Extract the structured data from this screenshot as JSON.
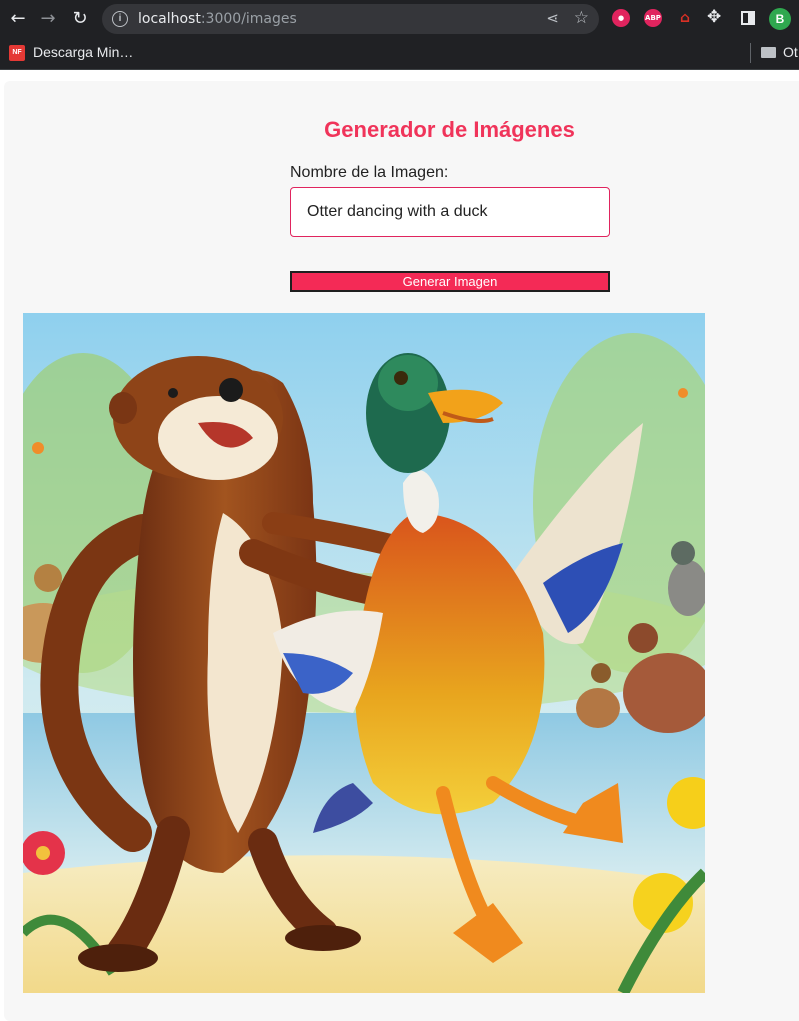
{
  "browser": {
    "url_host": "localhost",
    "url_path": ":3000/images",
    "profile_initial": "B",
    "extensions": [
      {
        "name": "record-extension",
        "label": "",
        "color": "#e0245e"
      },
      {
        "name": "adblock-extension",
        "label": "ABP",
        "color": "#e0245e"
      },
      {
        "name": "grad-cap-extension",
        "label": "",
        "color": "#c0392b"
      }
    ]
  },
  "bookmarks": {
    "item_label": "Descarga Min…",
    "item_favicon": "NF",
    "folder_label": "Ot"
  },
  "page": {
    "title": "Generador de Imágenes",
    "field_label": "Nombre de la Imagen:",
    "input_value": "Otter dancing with a duck",
    "button_label": "Generar Imagen"
  },
  "colors": {
    "accent": "#f0345a",
    "button": "#f42a56"
  }
}
